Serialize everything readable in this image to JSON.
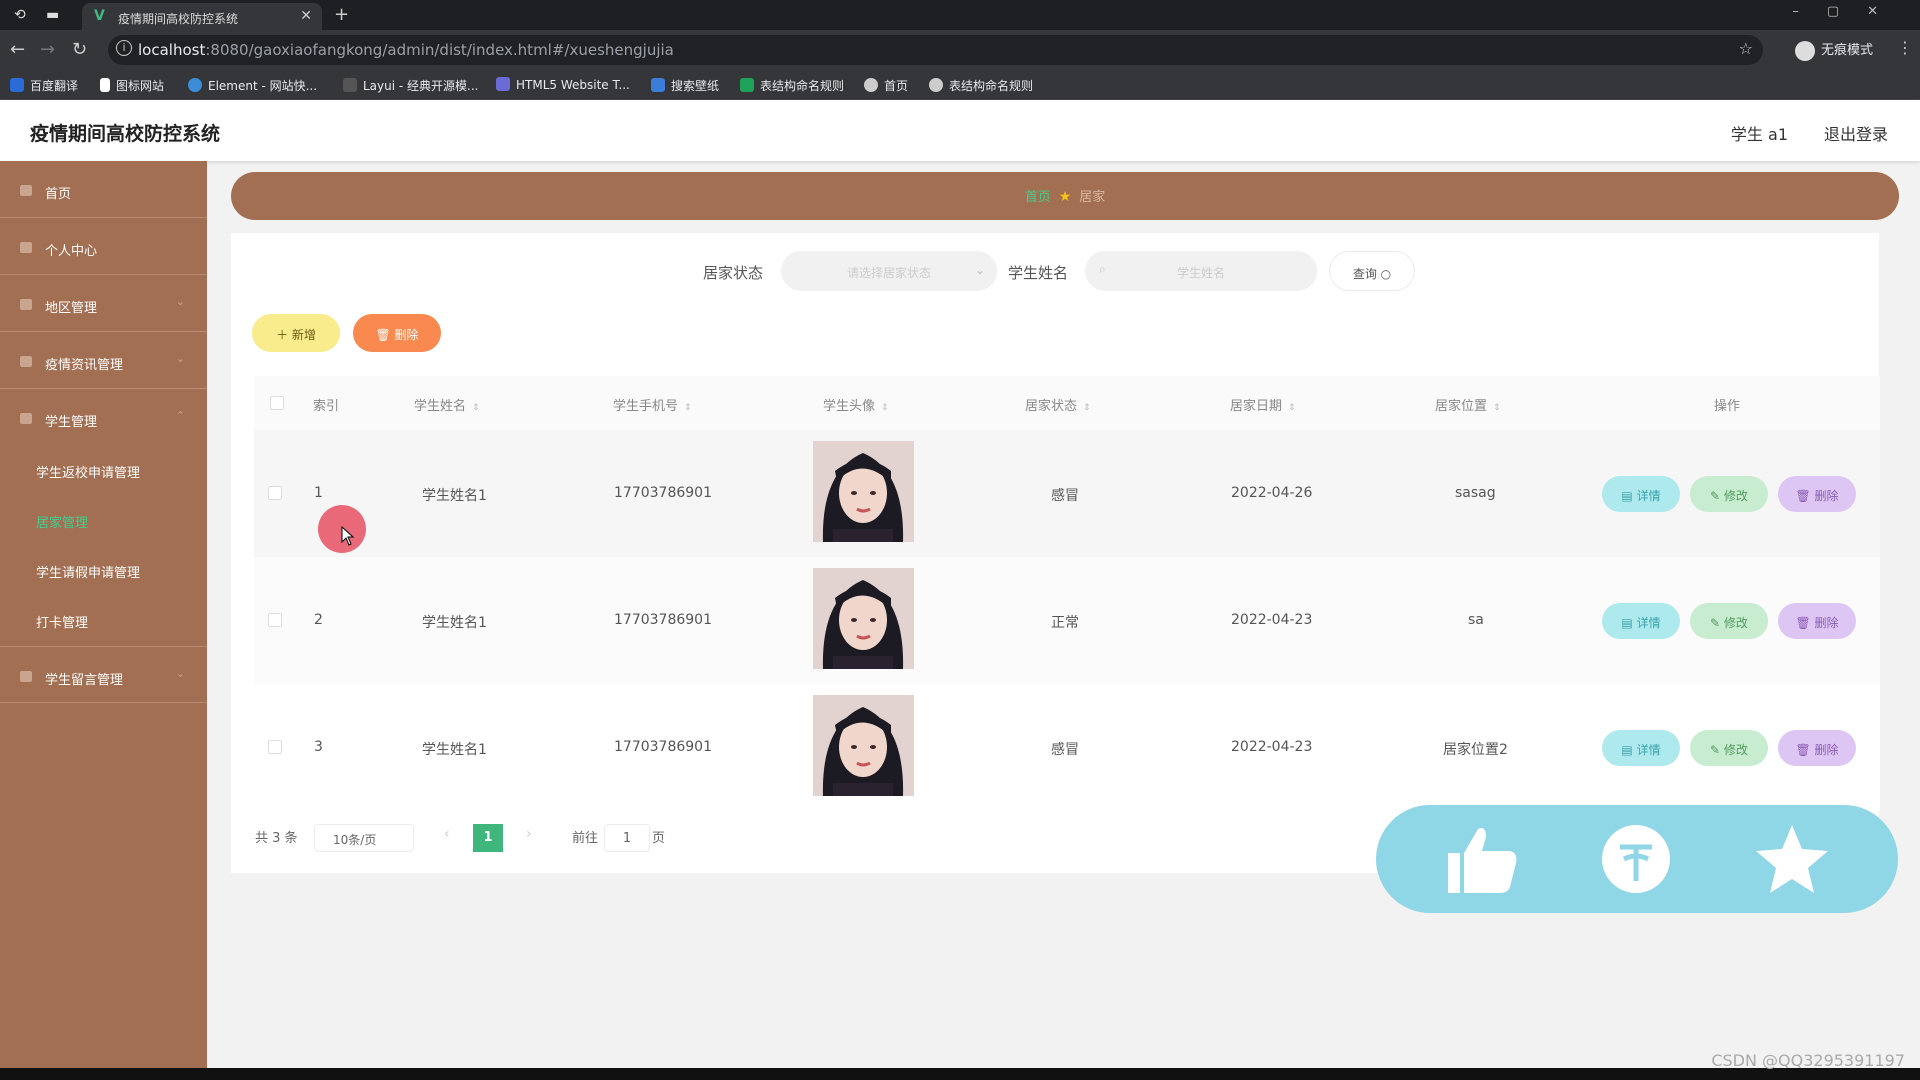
{
  "browser": {
    "tab_title": "疫情期间高校防控系统",
    "url_host": "localhost",
    "url_rest": ":8080/gaoxiaofangkong/admin/dist/index.html#/xueshengjujia",
    "incognito_label": "无痕模式",
    "bookmarks": [
      "百度翻译",
      "图标网站",
      "Element - 网站快...",
      "Layui - 经典开源模...",
      "HTML5 Website T...",
      "搜索壁纸",
      "表结构命名规则",
      "首页",
      "表结构命名规则"
    ]
  },
  "header": {
    "title": "疫情期间高校防控系统",
    "user": "学生 a1",
    "logout": "退出登录"
  },
  "sidebar": {
    "items": [
      "首页",
      "个人中心",
      "地区管理",
      "疫情资讯管理",
      "学生管理",
      "学生留言管理"
    ],
    "subitems": [
      "学生返校申请管理",
      "居家管理",
      "学生请假申请管理",
      "打卡管理"
    ],
    "active_sub": "居家管理"
  },
  "breadcrumb": {
    "home": "首页",
    "current": "居家"
  },
  "search": {
    "status_label": "居家状态",
    "status_placeholder": "请选择居家状态",
    "name_label": "学生姓名",
    "name_placeholder": "学生姓名",
    "query_button": "查询"
  },
  "actions": {
    "add": "新增",
    "delete": "删除"
  },
  "table": {
    "headers": [
      "索引",
      "学生姓名",
      "学生手机号",
      "学生头像",
      "居家状态",
      "居家日期",
      "居家位置",
      "操作"
    ],
    "rows": [
      {
        "index": "1",
        "name": "学生姓名1",
        "phone": "17703786901",
        "status": "感冒",
        "date": "2022-04-26",
        "location": "sasag"
      },
      {
        "index": "2",
        "name": "学生姓名1",
        "phone": "17703786901",
        "status": "正常",
        "date": "2022-04-23",
        "location": "sa"
      },
      {
        "index": "3",
        "name": "学生姓名1",
        "phone": "17703786901",
        "status": "感冒",
        "date": "2022-04-23",
        "location": "居家位置2"
      }
    ],
    "row_actions": {
      "detail": "详情",
      "edit": "修改",
      "delete": "删除"
    }
  },
  "pagination": {
    "total": "共 3 条",
    "page_size": "10条/页",
    "current_page": "1",
    "goto_prefix": "前往",
    "goto_value": "1",
    "goto_suffix": "页"
  },
  "floating_bar": {
    "icons": [
      "thumbs-up-icon",
      "coin-icon",
      "star-icon"
    ]
  },
  "watermark": "CSDN @QQ3295391197",
  "colors": {
    "sidebar": "#a36f52",
    "accent": "#3fb67b",
    "float": "#8fd6e7"
  }
}
